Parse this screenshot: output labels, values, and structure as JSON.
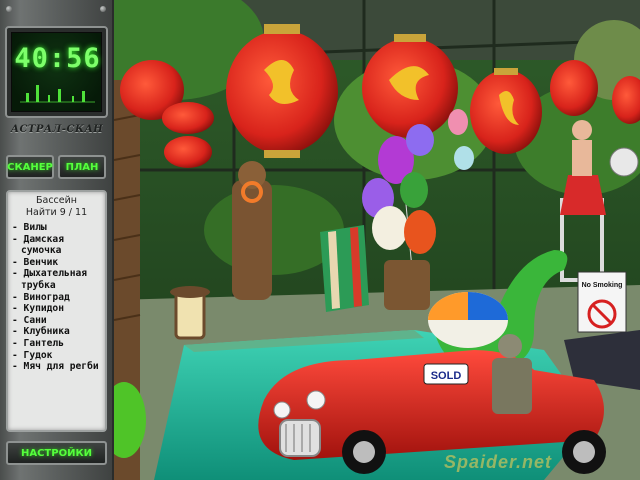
{
  "hud": {
    "timer": "40:56",
    "device_name": "АСТРАЛ-СКАН",
    "scanner_label": "СКАНЕР",
    "plan_label": "ПЛАН",
    "settings_label": "НАСТРОЙКИ"
  },
  "objectives": {
    "location": "Бассейн",
    "progress_text": "Найти 9 / 11",
    "found": 9,
    "total": 11,
    "items": [
      "- Вилы",
      "- Дамская сумочка",
      "- Венчик",
      "- Дыхательная трубка",
      "- Виноград",
      "- Купидон",
      "- Сани",
      "- Клубника",
      "- Гантель",
      "- Гудок",
      "- Мяч для регби"
    ]
  },
  "scene": {
    "sign_text": "No Smoking",
    "sold_text": "SOLD",
    "watermark": "Spaider.net"
  },
  "colors": {
    "lcd_green": "#7dff6a",
    "lantern_red": "#d8231b",
    "pool_water": "#1bb59a"
  },
  "icons": [
    "dragon-lantern-icon",
    "no-smoking-icon",
    "balloon-icon"
  ]
}
